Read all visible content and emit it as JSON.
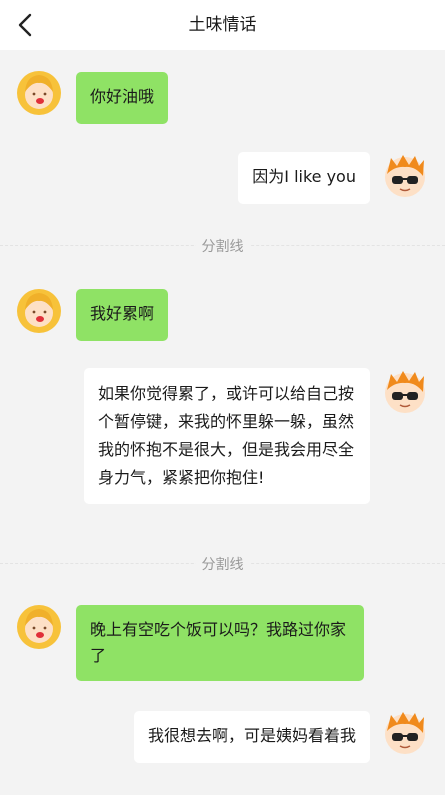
{
  "header": {
    "title": "土味情话"
  },
  "colors": {
    "left_bubble": "#8fe265",
    "right_bubble": "#ffffff",
    "background": "#f3f3f3",
    "divider_text": "#999999"
  },
  "messages": [
    {
      "side": "left",
      "text": "你好油哦"
    },
    {
      "side": "right",
      "text": "因为I like you"
    },
    {
      "side": "divider",
      "text": "分割线"
    },
    {
      "side": "left",
      "text": "我好累啊"
    },
    {
      "side": "right",
      "text": "如果你觉得累了，或许可以给自己按个暂停键，来我的怀里躲一躲，虽然我的怀抱不是很大，但是我会用尽全身力气，紧紧把你抱住!"
    },
    {
      "side": "divider",
      "text": "分割线"
    },
    {
      "side": "left",
      "text": "晚上有空吃个饭可以吗？我路过你家了"
    },
    {
      "side": "right",
      "text": "我很想去啊，可是姨妈看着我"
    }
  ]
}
